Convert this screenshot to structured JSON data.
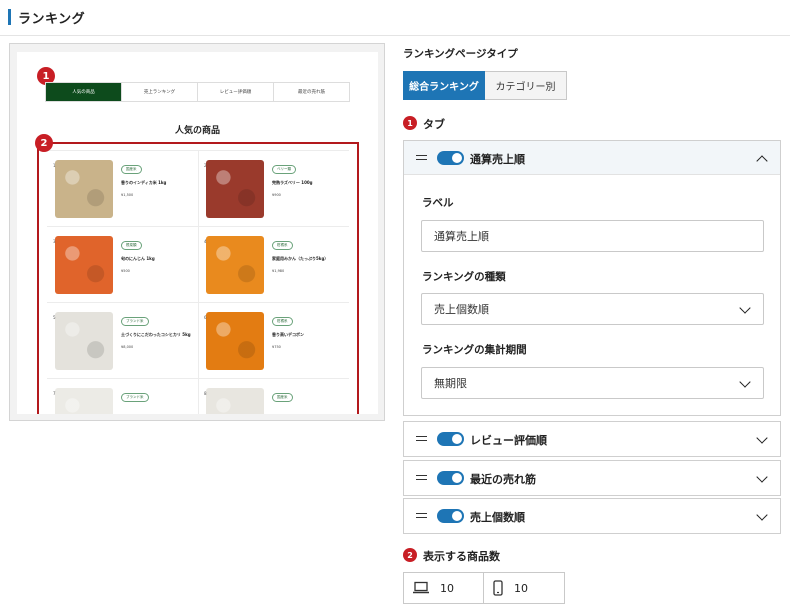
{
  "header": {
    "title": "ランキング"
  },
  "preview": {
    "badge1": "1",
    "badge2": "2",
    "tabs": [
      "人気の商品",
      "売上ランキング",
      "レビュー評価順",
      "最近の売れ筋"
    ],
    "title": "人気の商品",
    "products": [
      {
        "num": "1",
        "badge": "国産米",
        "name": "香りのインディカ米 1kg",
        "price": "¥1,500",
        "color": "#c9b38a"
      },
      {
        "num": "2",
        "badge": "ベリー類",
        "name": "完熟ラズベリー 100g",
        "price": "¥900",
        "color": "#9a3a2c"
      },
      {
        "num": "3",
        "badge": "根菜類",
        "name": "旬のにんじん 1kg",
        "price": "¥500",
        "color": "#e0642b"
      },
      {
        "num": "4",
        "badge": "柑橘系",
        "name": "家庭用みかん（たっぷり5kg）",
        "price": "¥1,980",
        "color": "#e98a1e"
      },
      {
        "num": "5",
        "badge": "ブランド米",
        "name": "土づくりにこだわったコシヒカリ 5kg",
        "price": "¥8,000",
        "color": "#e4e2dc"
      },
      {
        "num": "6",
        "badge": "柑橘系",
        "name": "香り高いデコポン",
        "price": "¥750",
        "color": "#e37c12"
      },
      {
        "num": "7",
        "badge": "ブランド米",
        "name": "",
        "price": "",
        "color": "#ecebe6"
      },
      {
        "num": "8",
        "badge": "国産米",
        "name": "",
        "price": "",
        "color": "#e8e6e0"
      }
    ]
  },
  "settings": {
    "page_type_label": "ランキングページタイプ",
    "page_type_options": [
      "総合ランキング",
      "カテゴリー別"
    ],
    "tab_section_num": "1",
    "tab_section_label": "タブ",
    "tabs": [
      {
        "label": "通算売上順",
        "expanded": true
      },
      {
        "label": "レビュー評価順",
        "expanded": false
      },
      {
        "label": "最近の売れ筋",
        "expanded": false
      },
      {
        "label": "売上個数順",
        "expanded": false
      }
    ],
    "expanded": {
      "label_title": "ラベル",
      "label_value": "通算売上順",
      "type_title": "ランキングの種類",
      "type_value": "売上個数順",
      "period_title": "ランキングの集計期間",
      "period_value": "無期限"
    },
    "count_num": "2",
    "count_label": "表示する商品数",
    "desktop_count": "10",
    "mobile_count": "10"
  }
}
